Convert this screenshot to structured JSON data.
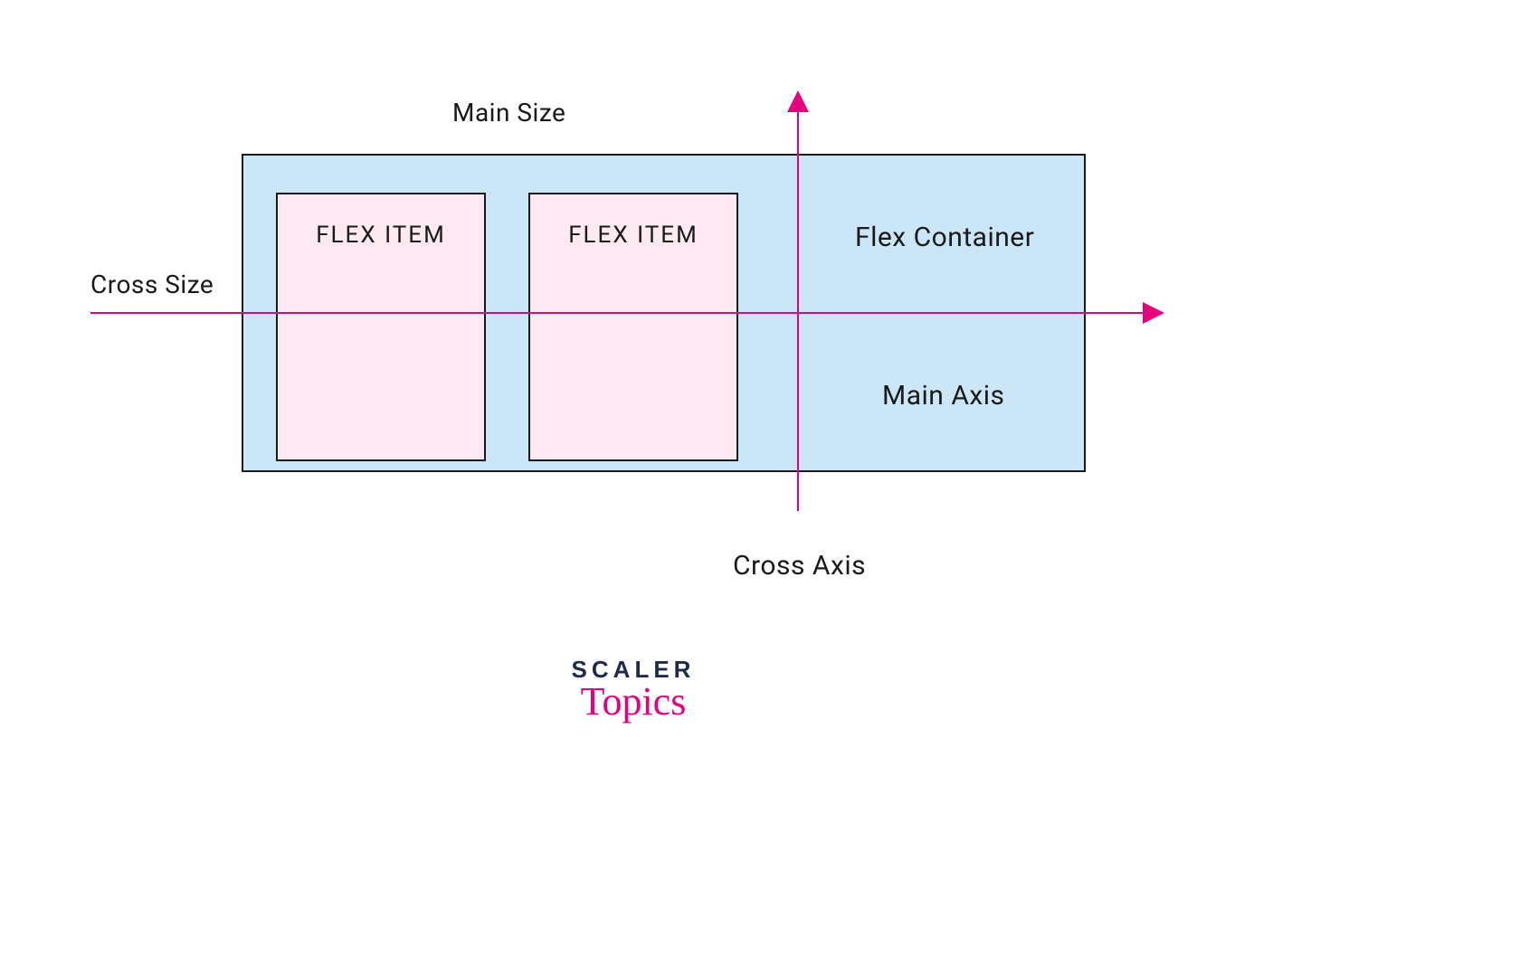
{
  "labels": {
    "main_size": "Main Size",
    "cross_size": "Cross Size",
    "flex_item_1": "FLEX ITEM",
    "flex_item_2": "FLEX ITEM",
    "flex_container": "Flex Container",
    "main_axis": "Main Axis",
    "cross_axis": "Cross Axis"
  },
  "logo": {
    "line1": "SCALER",
    "line2": "Topics"
  },
  "colors": {
    "accent": "#e6007e",
    "container_fill": "#cbe7f7",
    "item_fill": "#fce9f1",
    "text": "#1a1a1a",
    "logo_dark": "#1d2a4a"
  }
}
